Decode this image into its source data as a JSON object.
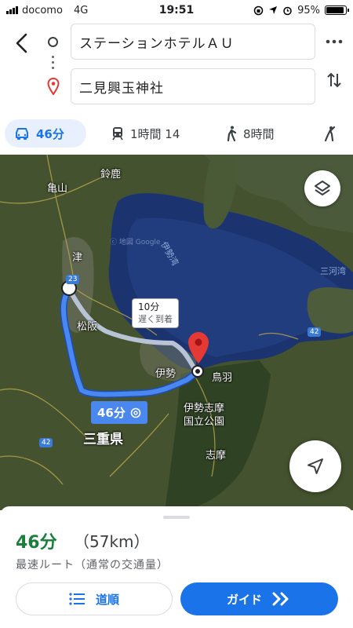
{
  "status_bar": {
    "carrier": "docomo",
    "network": "4G",
    "time": "19:51",
    "battery": "95%"
  },
  "search": {
    "origin": "ステーションホテルＡＵ",
    "destination": "二見興玉神社"
  },
  "modes": [
    {
      "icon": "car-icon",
      "label": "46分",
      "active": true
    },
    {
      "icon": "train-icon",
      "label": "1時間 14"
    },
    {
      "icon": "walk-icon",
      "label": "8時間"
    },
    {
      "icon": "rideshare-icon",
      "label": ""
    }
  ],
  "map": {
    "labels": {
      "suzuka": "鈴鹿",
      "kameyama": "亀山",
      "tsu": "津",
      "matsusaka": "松阪",
      "ise": "伊勢",
      "toba": "鳥羽",
      "mie": "三重県",
      "park1": "伊勢志摩",
      "park2": "国立公園",
      "shima": "志摩",
      "ise_bay": "伊勢湾",
      "mikawa": "三河湾",
      "watermark": "ⓒ 地図 Google"
    },
    "road_badges": {
      "r23": "23",
      "r42a": "42",
      "r42b": "42"
    },
    "alt_route": {
      "time": "10分",
      "note": "遅く到着"
    },
    "main_route": {
      "time": "46分"
    }
  },
  "sheet": {
    "duration": "46分",
    "distance": "（57km）",
    "description": "最速ルート（通常の交通量）",
    "steps_label": "道順",
    "guide_label": "ガイド"
  },
  "colors": {
    "accent": "#1a73e8",
    "route": "#4a87ee",
    "duration": "#188038",
    "pin": "#e53935"
  }
}
